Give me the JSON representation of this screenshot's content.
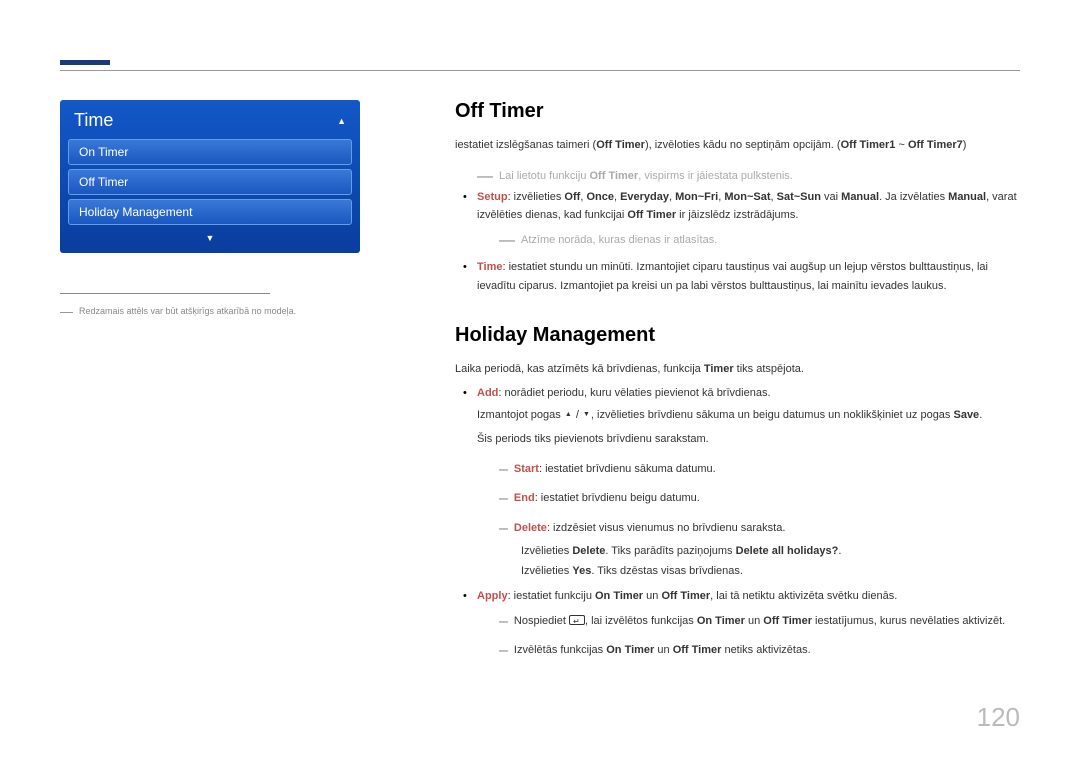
{
  "menu": {
    "title": "Time",
    "items": [
      "On Timer",
      "Off Timer",
      "Holiday Management"
    ]
  },
  "left_note": {
    "dash": "―",
    "text": "Redzamais attēls var būt atšķirīgs atkarībā no modeļa."
  },
  "section1": {
    "heading": "Off Timer",
    "p1_a": "iestatiet izslēgšanas taimeri (",
    "p1_b": "Off Timer",
    "p1_c": "), izvēloties kādu no septiņām opcijām. (",
    "p1_d": "Off Timer1",
    "p1_e": " ~ ",
    "p1_f": "Off Timer7",
    "p1_g": ")",
    "gray1_a": "Lai lietotu funkciju ",
    "gray1_b": "Off Timer",
    "gray1_c": ", vispirms ir jāiestata pulkstenis.",
    "b1": {
      "label": "Setup",
      "t1": ": izvēlieties ",
      "o1": "Off",
      "o2": "Once",
      "o3": "Everyday",
      "o4": "Mon~Fri",
      "o5": "Mon~Sat",
      "o6": "Sat~Sun",
      "or": " vai ",
      "o7": "Manual",
      "t2": ". Ja izvēlaties ",
      "o7b": "Manual",
      "t3": ", varat izvēlēties dienas, kad funkcijai ",
      "off": "Off Timer",
      "t4": " ir jāizslēdz izstrādājums."
    },
    "gray2_a": "Atzīme norāda, kuras dienas ir atlasītas.",
    "b2": {
      "label": "Time",
      "text": ": iestatiet stundu un minūti. Izmantojiet ciparu taustiņus vai augšup un lejup vērstos bulttaustiņus, lai ievadītu ciparus. Izmantojiet pa kreisi un pa labi vērstos bulttaustiņus, lai mainītu ievades laukus."
    }
  },
  "section2": {
    "heading": "Holiday Management",
    "p1_a": "Laika periodā, kas atzīmēts kā brīvdienas, funkcija ",
    "p1_b": "Timer",
    "p1_c": " tiks atspējota.",
    "add": {
      "label": "Add",
      "t1": ": norādiet periodu, kuru vēlaties pievienot kā brīvdienas.",
      "line2_a": "Izmantojot pogas ",
      "line2_b": ", izvēlieties brīvdienu sākuma un beigu datumus un noklikšķiniet uz pogas ",
      "save": "Save",
      "line2_c": ".",
      "line3": "Šis periods tiks pievienots brīvdienu sarakstam.",
      "start_l": "Start",
      "start_t": ": iestatiet brīvdienu sākuma datumu.",
      "end_l": "End",
      "end_t": ": iestatiet brīvdienu beigu datumu.",
      "del_l": "Delete",
      "del_t": ": izdzēsiet visus vienumus no brīvdienu saraksta.",
      "del_line2_a": "Izvēlieties ",
      "del_line2_b": "Delete",
      "del_line2_c": ". Tiks parādīts paziņojums ",
      "del_line2_d": "Delete all holidays?",
      "del_line2_e": ".",
      "del_line3_a": "Izvēlieties ",
      "del_line3_b": "Yes",
      "del_line3_c": ". Tiks dzēstas visas brīvdienas."
    },
    "apply": {
      "label": "Apply",
      "t1": ": iestatiet funkciju ",
      "on": "On Timer",
      "and": " un ",
      "off": "Off Timer",
      "t2": ", lai tā netiktu aktivizēta svētku dienās.",
      "s1_a": "Nospiediet ",
      "s1_b": ", lai izvēlētos funkcijas ",
      "s1_c": " iestatījumus, kurus nevēlaties aktivizēt.",
      "s2_a": "Izvēlētās funkcijas ",
      "s2_b": " netiks aktivizētas."
    }
  },
  "page_number": "120",
  "glyphs": {
    "comma": ", ",
    "dash": "―",
    "em": "–",
    "slash": " / "
  }
}
